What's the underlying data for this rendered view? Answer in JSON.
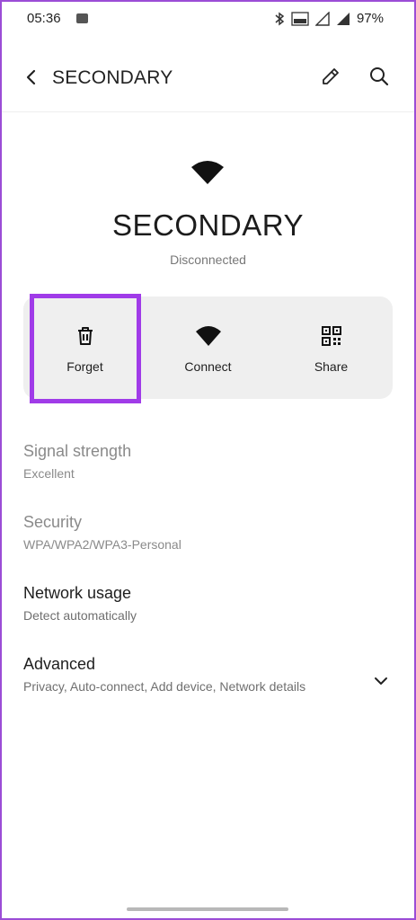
{
  "status_bar": {
    "time": "05:36",
    "battery": "97%",
    "icons": [
      "image-icon",
      "bluetooth-icon",
      "volte-icon",
      "signal-icon",
      "signal-icon",
      "battery"
    ]
  },
  "app_bar": {
    "title": "SECONDARY",
    "icons": [
      "back-arrow-icon",
      "pencil-icon",
      "search-icon"
    ]
  },
  "network": {
    "name": "SECONDARY",
    "status": "Disconnected"
  },
  "actions": [
    {
      "label": "Forget",
      "icon": "trash-icon"
    },
    {
      "label": "Connect",
      "icon": "wifi-icon"
    },
    {
      "label": "Share",
      "icon": "qr-code-icon"
    }
  ],
  "details": [
    {
      "title": "Signal strength",
      "subtitle": "Excellent"
    },
    {
      "title": "Security",
      "subtitle": "WPA/WPA2/WPA3-Personal"
    },
    {
      "title": "Network usage",
      "subtitle": "Detect automatically"
    },
    {
      "title": "Advanced",
      "subtitle": "Privacy, Auto-connect, Add device, Network details"
    }
  ],
  "colors": {
    "highlight": "#a03be8",
    "action_bg": "#efefef",
    "frame": "#9b4dd6"
  }
}
